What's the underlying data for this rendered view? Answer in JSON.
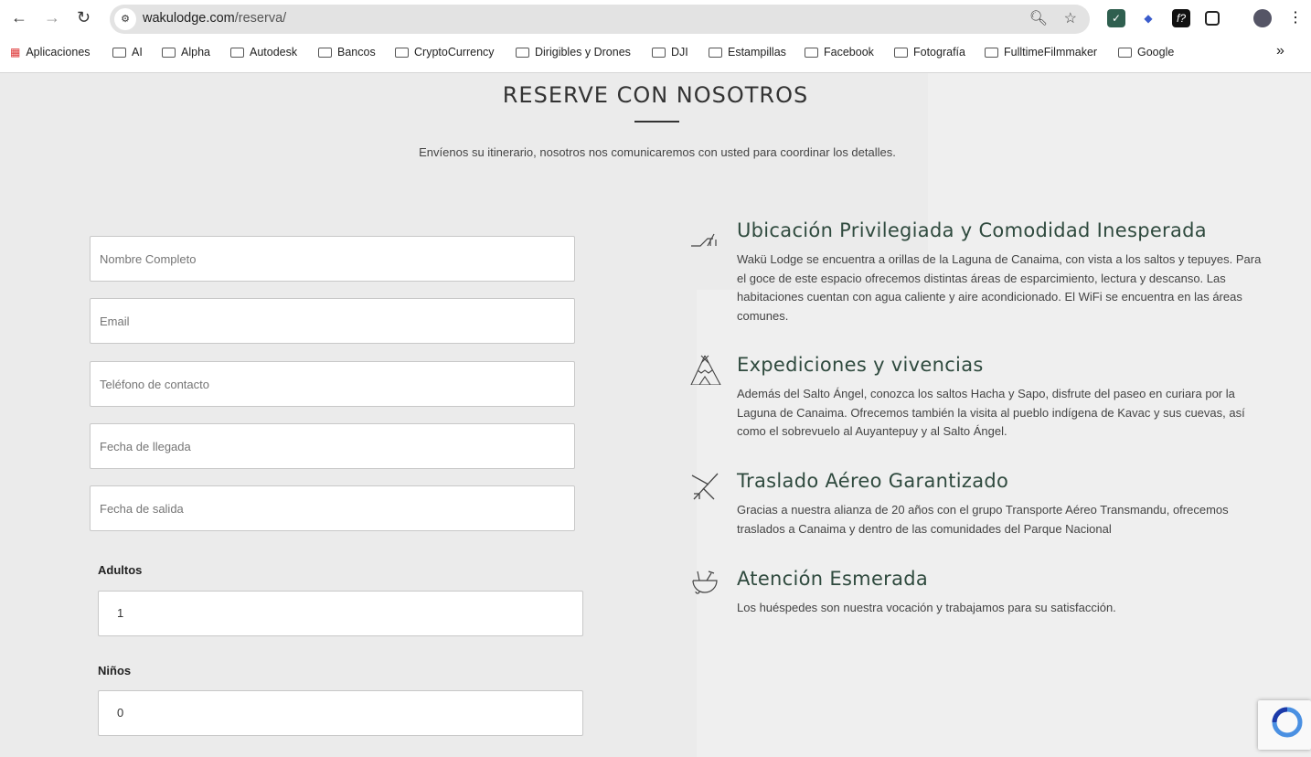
{
  "browser": {
    "url_host": "wakulodge.com",
    "url_path": "/reserva/",
    "bookmarks": [
      "Aplicaciones",
      "AI",
      "Alpha",
      "Autodesk",
      "Bancos",
      "CryptoCurrency",
      "Dirigibles y Drones",
      "DJI",
      "Estampillas",
      "Facebook",
      "Fotografía",
      "FulltimeFilmmaker",
      "Google"
    ],
    "more_bookmarks": "»"
  },
  "page": {
    "title": "RESERVE CON NOSOTROS",
    "subtitle": "Envíenos su itinerario, nosotros nos comunicaremos con usted para coordinar los detalles."
  },
  "form": {
    "name_placeholder": "Nombre Completo",
    "email_placeholder": "Email",
    "phone_placeholder": "Teléfono de contacto",
    "arrival_placeholder": "Fecha de llegada",
    "departure_placeholder": "Fecha de salida",
    "adults_label": "Adultos",
    "adults_value": "1",
    "children_label": "Niños",
    "children_value": "0"
  },
  "features": [
    {
      "icon": "lounge-chair-icon",
      "title": "Ubicación Privilegiada y Comodidad Inesperada",
      "text": "Wakü Lodge se encuentra a orillas de la Laguna de Canaima, con vista a los saltos y tepuyes. Para el goce de este espacio ofrecemos distintas áreas de esparcimiento, lectura y descanso. Las habitaciones cuentan con agua caliente y aire acondicionado. El WiFi se encuentra en las áreas comunes."
    },
    {
      "icon": "tent-icon",
      "title": "Expediciones y vivencias",
      "text": "Además del Salto Ángel, conozca los saltos Hacha y Sapo, disfrute del paseo en curiara por la Laguna de Canaima. Ofrecemos también la visita al pueblo indígena de Kavac y sus cuevas, así como el sobrevuelo al Auyantepuy y al Salto Ángel."
    },
    {
      "icon": "airplane-icon",
      "title": "Traslado Aéreo Garantizado",
      "text": "Gracias a nuestra alianza de 20 años con el grupo Transporte Aéreo Transmandu, ofrecemos traslados a Canaima y dentro de las comunidades del Parque Nacional"
    },
    {
      "icon": "cocktail-icon",
      "title": "Atención Esmerada",
      "text": "Los huéspedes son nuestra vocación y trabajamos para su satisfacción."
    }
  ],
  "colors": {
    "heading": "#2f4a3e",
    "background": "#ebebeb"
  }
}
